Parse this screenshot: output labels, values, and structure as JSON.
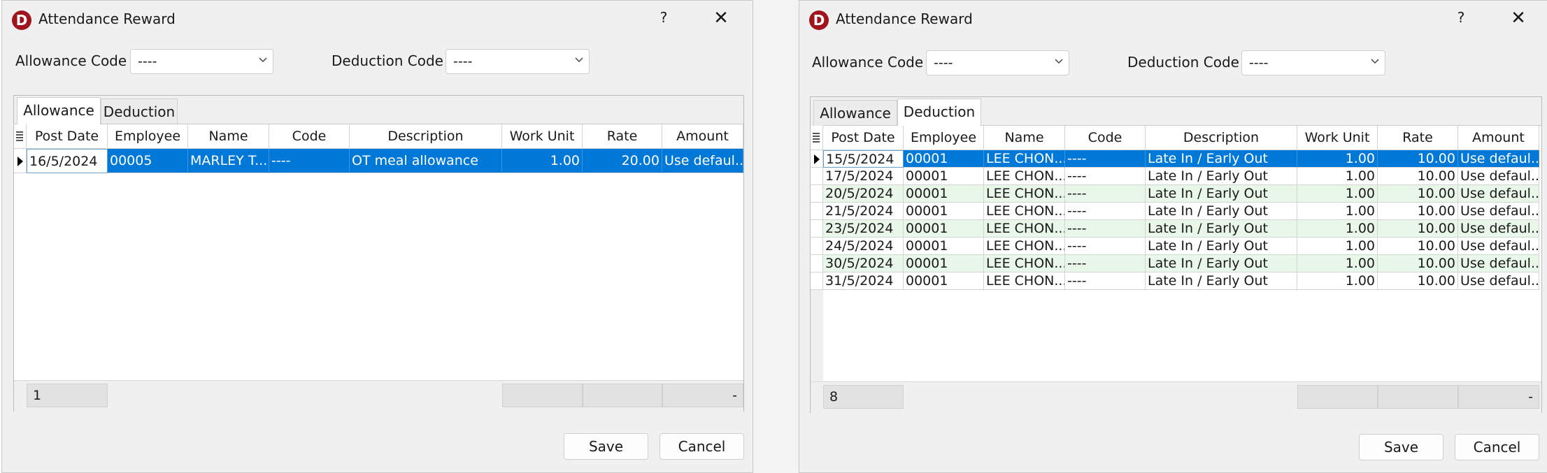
{
  "dialogs": [
    {
      "title": "Attendance Reward",
      "help": "?",
      "close": "✕",
      "allowance_label": "Allowance Code",
      "allowance_value": "----",
      "deduction_label": "Deduction Code",
      "deduction_value": "----",
      "tabs": [
        "Allowance",
        "Deduction"
      ],
      "active_tab": "Allowance",
      "columns": [
        "Post Date",
        "Employee",
        "Name",
        "Code",
        "Description",
        "Work Unit",
        "Rate",
        "Amount"
      ],
      "rows": [
        {
          "post_date": "16/5/2024",
          "employee": "00005",
          "name": "MARLEY T...",
          "code": "----",
          "description": "OT meal allowance",
          "work_unit": "1.00",
          "rate": "20.00",
          "amount": "Use defaul..."
        }
      ],
      "footer_count": "1",
      "footer_amount": "-",
      "save": "Save",
      "cancel": "Cancel"
    },
    {
      "title": "Attendance Reward",
      "help": "?",
      "close": "✕",
      "allowance_label": "Allowance Code",
      "allowance_value": "----",
      "deduction_label": "Deduction Code",
      "deduction_value": "----",
      "tabs": [
        "Allowance",
        "Deduction"
      ],
      "active_tab": "Deduction",
      "columns": [
        "Post Date",
        "Employee",
        "Name",
        "Code",
        "Description",
        "Work Unit",
        "Rate",
        "Amount"
      ],
      "rows": [
        {
          "post_date": "15/5/2024",
          "employee": "00001",
          "name": "LEE CHON...",
          "code": "----",
          "description": "Late In / Early Out",
          "work_unit": "1.00",
          "rate": "10.00",
          "amount": "Use defaul..."
        },
        {
          "post_date": "17/5/2024",
          "employee": "00001",
          "name": "LEE CHON...",
          "code": "----",
          "description": "Late In / Early Out",
          "work_unit": "1.00",
          "rate": "10.00",
          "amount": "Use defaul..."
        },
        {
          "post_date": "20/5/2024",
          "employee": "00001",
          "name": "LEE CHON...",
          "code": "----",
          "description": "Late In / Early Out",
          "work_unit": "1.00",
          "rate": "10.00",
          "amount": "Use defaul..."
        },
        {
          "post_date": "21/5/2024",
          "employee": "00001",
          "name": "LEE CHON...",
          "code": "----",
          "description": "Late In / Early Out",
          "work_unit": "1.00",
          "rate": "10.00",
          "amount": "Use defaul..."
        },
        {
          "post_date": "23/5/2024",
          "employee": "00001",
          "name": "LEE CHON...",
          "code": "----",
          "description": "Late In / Early Out",
          "work_unit": "1.00",
          "rate": "10.00",
          "amount": "Use defaul..."
        },
        {
          "post_date": "24/5/2024",
          "employee": "00001",
          "name": "LEE CHON...",
          "code": "----",
          "description": "Late In / Early Out",
          "work_unit": "1.00",
          "rate": "10.00",
          "amount": "Use defaul..."
        },
        {
          "post_date": "30/5/2024",
          "employee": "00001",
          "name": "LEE CHON...",
          "code": "----",
          "description": "Late In / Early Out",
          "work_unit": "1.00",
          "rate": "10.00",
          "amount": "Use defaul..."
        },
        {
          "post_date": "31/5/2024",
          "employee": "00001",
          "name": "LEE CHON...",
          "code": "----",
          "description": "Late In / Early Out",
          "work_unit": "1.00",
          "rate": "10.00",
          "amount": "Use defaul..."
        }
      ],
      "footer_count": "8",
      "footer_amount": "-",
      "save": "Save",
      "cancel": "Cancel"
    }
  ],
  "colors": {
    "selection": "#0078d7",
    "alt_row": "#e8f7e8",
    "app_icon": "#a0141e"
  }
}
